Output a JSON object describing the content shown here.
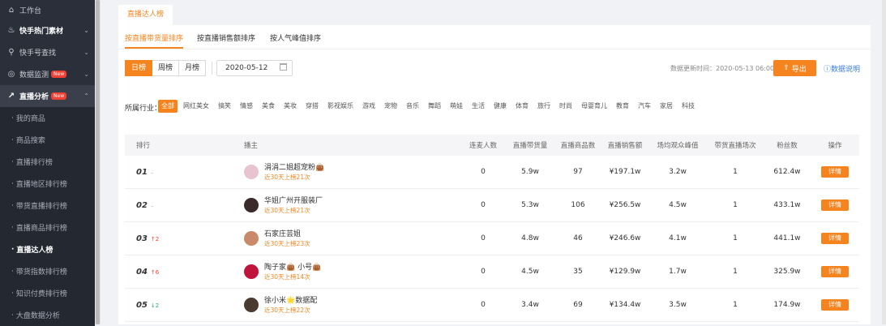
{
  "sidebar": {
    "items": [
      {
        "label": "工作台",
        "icon": "home-icon"
      },
      {
        "label": "快手热门素材",
        "icon": "fire-icon"
      },
      {
        "label": "快手号查找",
        "icon": "search-icon"
      },
      {
        "label": "数据监测",
        "icon": "monitor-icon",
        "badge": "New"
      },
      {
        "label": "直播分析",
        "icon": "chart-icon",
        "badge": "New"
      }
    ],
    "sub_items": [
      "我的商品",
      "商品搜索",
      "直播排行榜",
      "直播地区排行榜",
      "带货直播排行榜",
      "直播商品排行榜",
      "直播达人榜",
      "带货指数排行榜",
      "知识付费排行榜",
      "大盘数据分析"
    ]
  },
  "page": {
    "top_tab": "直播达人榜",
    "sub_tabs": [
      "按直播带货量排序",
      "按直播销售额排序",
      "按人气峰值排序"
    ],
    "periods": [
      "日榜",
      "周榜",
      "月榜"
    ],
    "date": "2020-05-12",
    "update_time": "数据更新时间：2020-05-13 06:00",
    "export_label": "导出",
    "doc_label": "数据说明",
    "industry_label": "所属行业：",
    "industries": [
      "全部",
      "网红美女",
      "搞笑",
      "情感",
      "美食",
      "美妆",
      "穿搭",
      "影视娱乐",
      "游戏",
      "宠物",
      "音乐",
      "舞蹈",
      "萌娃",
      "生活",
      "健康",
      "体育",
      "旅行",
      "时尚",
      "母婴育儿",
      "教育",
      "汽车",
      "家居",
      "科技"
    ]
  },
  "table": {
    "headers": [
      "排行",
      "播主",
      "连麦人数",
      "直播带货量",
      "直播商品数",
      "直播销售额",
      "场均观众峰值",
      "带货直播场次",
      "粉丝数",
      "操作"
    ],
    "detail_label": "详情",
    "rows": [
      {
        "rank": "01",
        "trend": "–",
        "trend_dir": "flat",
        "name": "涓涓二姐超宠粉👜",
        "sub": "近30天上榜21次",
        "lianmai": "0",
        "volume": "5.9w",
        "items": "97",
        "sales": "¥197.1w",
        "peak": "3.2w",
        "sessions": "1",
        "fans": "612.4w",
        "avatar_color": "#e8c3d0"
      },
      {
        "rank": "02",
        "trend": "–",
        "trend_dir": "flat",
        "name": "华姐广州开服装厂",
        "sub": "近30天上榜21次",
        "lianmai": "0",
        "volume": "5.3w",
        "items": "106",
        "sales": "¥256.5w",
        "peak": "4.5w",
        "sessions": "1",
        "fans": "433.1w",
        "avatar_color": "#3a2a2a"
      },
      {
        "rank": "03",
        "trend": "↑2",
        "trend_dir": "up",
        "name": "石家庄芸姐",
        "sub": "近30天上榜23次",
        "lianmai": "0",
        "volume": "4.8w",
        "items": "46",
        "sales": "¥246.6w",
        "peak": "4.1w",
        "sessions": "1",
        "fans": "441.1w",
        "avatar_color": "#c98a6a"
      },
      {
        "rank": "04",
        "trend": "↑6",
        "trend_dir": "up",
        "name": "陶子家👜 小号👜",
        "sub": "近30天上榜14次",
        "lianmai": "0",
        "volume": "4.5w",
        "items": "35",
        "sales": "¥129.9w",
        "peak": "1.7w",
        "sessions": "1",
        "fans": "325.9w",
        "avatar_color": "#c0143c"
      },
      {
        "rank": "05",
        "trend": "↓2",
        "trend_dir": "down",
        "name": "徐小米🌟数据配",
        "sub": "近30天上榜22次",
        "lianmai": "0",
        "volume": "3.4w",
        "items": "69",
        "sales": "¥134.4w",
        "peak": "3.5w",
        "sessions": "1",
        "fans": "174.9w",
        "avatar_color": "#4a3a30"
      }
    ]
  }
}
